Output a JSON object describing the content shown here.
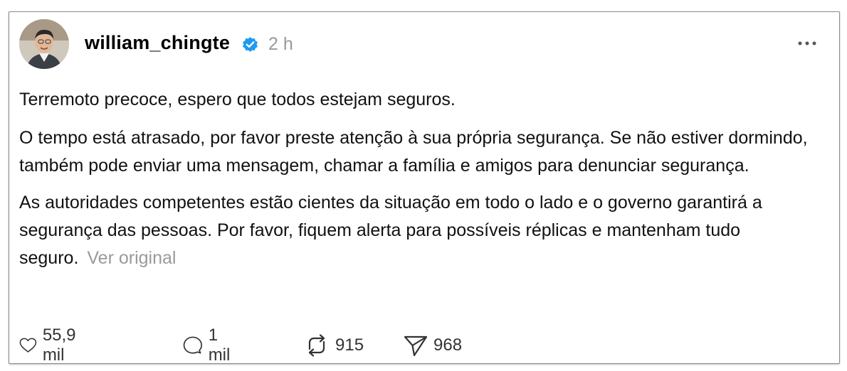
{
  "post": {
    "author": {
      "handle": "william_chingte",
      "verified": true,
      "time_ago": "2 h"
    },
    "paragraphs": [
      "Terremoto precoce, espero que todos estejam seguros.",
      "O tempo está atrasado, por favor preste atenção à sua própria segurança. Se não estiver dormindo, também pode enviar uma mensagem, chamar a família e amigos para denunciar segurança.",
      "As autoridades competentes estão cientes da situação em todo o lado e o governo garantirá a segurança das pessoas. Por favor, fiquem alerta para possíveis réplicas e mantenham tudo seguro."
    ],
    "see_original_label": "Ver original"
  },
  "actions": {
    "likes": "55,9 mil",
    "replies": "1 mil",
    "reposts": "915",
    "shares": "968"
  },
  "icons": {
    "verified": "verified-badge-icon",
    "more": "more-options-icon",
    "like": "heart-icon",
    "reply": "comment-bubble-icon",
    "repost": "repost-icon",
    "share": "send-icon"
  },
  "colors": {
    "verified_badge": "#1d9bf0",
    "muted_text": "#999999"
  }
}
